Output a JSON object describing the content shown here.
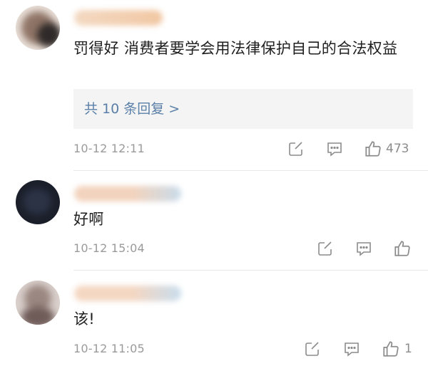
{
  "comments": [
    {
      "text": "罚得好 消费者要学会用法律保护自己的合法权益",
      "replies_label": "共 10 条回复 >",
      "time": "10-12 12:11",
      "like_count": "473",
      "colors": {
        "avatar_a": "#e9dfd8",
        "avatar_b": "#8f7466",
        "name_a": "#f3d9c2",
        "name_b": "#f1c7a3"
      }
    },
    {
      "text": "好啊",
      "time": "10-12 15:04",
      "like_count": "",
      "colors": {
        "avatar_a": "#1b1f2a",
        "avatar_b": "#2b3345",
        "name_a": "#f2d3bd",
        "name_b": "#c9dbea"
      }
    },
    {
      "text": "该!",
      "time": "10-12 11:05",
      "like_count": "1",
      "colors": {
        "avatar_a": "#d9cfcb",
        "avatar_b": "#6f5b58",
        "name_a": "#f4d7c2",
        "name_b": "#c8dced"
      }
    }
  ],
  "icons": {
    "edit": "edit-icon",
    "comment": "comment-icon",
    "like": "thumbs-up-icon"
  },
  "colors": {
    "reply_link": "#5a7fa8",
    "meta": "#9a9a9a",
    "reply_bg": "#f4f4f4"
  }
}
